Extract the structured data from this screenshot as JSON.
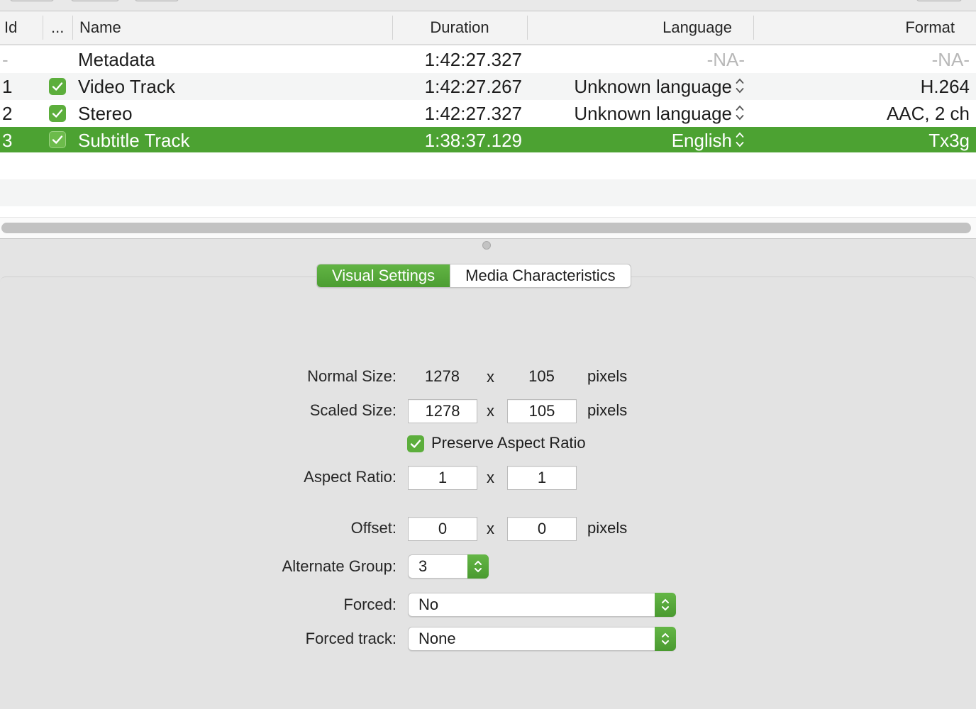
{
  "table": {
    "columns": {
      "id": "Id",
      "enabled": "...",
      "name": "Name",
      "duration": "Duration",
      "language": "Language",
      "format": "Format"
    },
    "rows": [
      {
        "id": "-",
        "name": "Metadata",
        "duration": "1:42:27.327",
        "language": "-NA-",
        "format": "-NA-"
      },
      {
        "id": "1",
        "name": "Video Track",
        "duration": "1:42:27.267",
        "language": "Unknown language",
        "format": "H.264"
      },
      {
        "id": "2",
        "name": "Stereo",
        "duration": "1:42:27.327",
        "language": "Unknown language",
        "format": "AAC, 2 ch"
      },
      {
        "id": "3",
        "name": "Subtitle Track",
        "duration": "1:38:37.129",
        "language": "English",
        "format": "Tx3g"
      }
    ]
  },
  "tabs": {
    "visual": "Visual Settings",
    "media": "Media Characteristics"
  },
  "settings": {
    "normal_size_label": "Normal Size:",
    "normal_width": "1278",
    "normal_height": "105",
    "scaled_size_label": "Scaled Size:",
    "scaled_width": "1278",
    "scaled_height": "105",
    "times": "x",
    "pixels": "pixels",
    "preserve_label": "Preserve Aspect Ratio",
    "aspect_label": "Aspect Ratio:",
    "aspect_w": "1",
    "aspect_h": "1",
    "offset_label": "Offset:",
    "offset_x": "0",
    "offset_y": "0",
    "alt_group_label": "Alternate Group:",
    "alt_group_value": "3",
    "forced_label": "Forced:",
    "forced_value": "No",
    "forced_track_label": "Forced track:",
    "forced_track_value": "None"
  },
  "colors": {
    "accent": "#4ca232",
    "accent_light": "#5cae3c"
  },
  "icons": {
    "check": "checkmark-icon",
    "stepper": "up-down-chevron-icon"
  }
}
